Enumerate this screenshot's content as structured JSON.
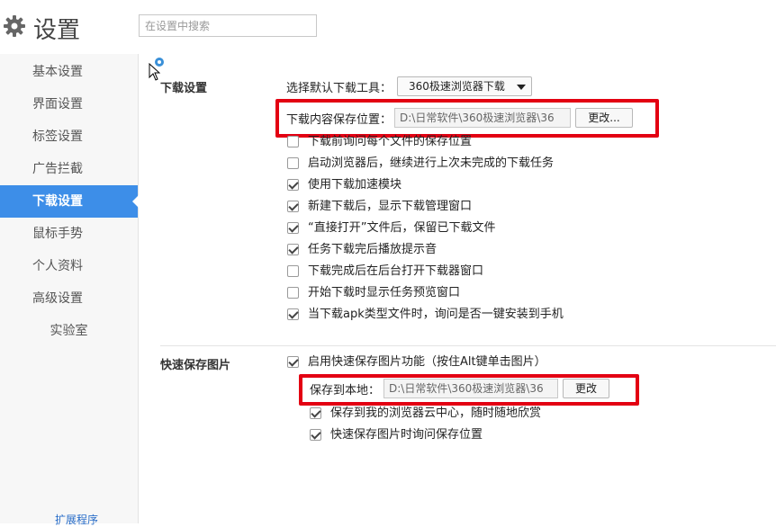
{
  "header": {
    "title": "设置",
    "search": {
      "placeholder": "在设置中搜索",
      "value": ""
    }
  },
  "sidebar": {
    "items": [
      {
        "label": "基本设置",
        "active": false
      },
      {
        "label": "界面设置",
        "active": false
      },
      {
        "label": "标签设置",
        "active": false
      },
      {
        "label": "广告拦截",
        "active": false
      },
      {
        "label": "下载设置",
        "active": true
      },
      {
        "label": "鼠标手势",
        "active": false
      },
      {
        "label": "个人资料",
        "active": false
      },
      {
        "label": "高级设置",
        "active": false
      },
      {
        "label": "实验室",
        "active": false
      }
    ],
    "ext_link": "扩展程序"
  },
  "download": {
    "title": "下载设置",
    "tool_label": "选择默认下载工具：",
    "tool_selected": "360极速浏览器下载",
    "save_label": "下载内容保存位置：",
    "save_path": "D:\\日常软件\\360极速浏览器\\36",
    "change_label": "更改...",
    "options": [
      {
        "label": "下载前询问每个文件的保存位置",
        "checked": false
      },
      {
        "label": "启动浏览器后，继续进行上次未完成的下载任务",
        "checked": false
      },
      {
        "label": "使用下载加速模块",
        "checked": true
      },
      {
        "label": "新建下载后，显示下载管理窗口",
        "checked": true
      },
      {
        "label": "“直接打开”文件后，保留已下载文件",
        "checked": true
      },
      {
        "label": "任务下载完后播放提示音",
        "checked": true
      },
      {
        "label": "下载完成后在后台打开下载器窗口",
        "checked": false
      },
      {
        "label": "开始下载时显示任务预览窗口",
        "checked": false
      },
      {
        "label": "当下载apk类型文件时，询问是否一键安装到手机",
        "checked": true
      }
    ]
  },
  "quicksave": {
    "title": "快速保存图片",
    "enable_label": "启用快速保存图片功能（按住Alt键单击图片）",
    "enable_checked": true,
    "local_label": "保存到本地：",
    "local_path": "D:\\日常软件\\360极速浏览器\\36",
    "change_label": "更改",
    "sub_options": [
      {
        "label": "保存到我的浏览器云中心，随时随地欣赏",
        "checked": true
      },
      {
        "label": "快速保存图片时询问保存位置",
        "checked": true
      }
    ]
  },
  "colors": {
    "accent": "#3d8ee8",
    "highlight": "#e30012"
  }
}
